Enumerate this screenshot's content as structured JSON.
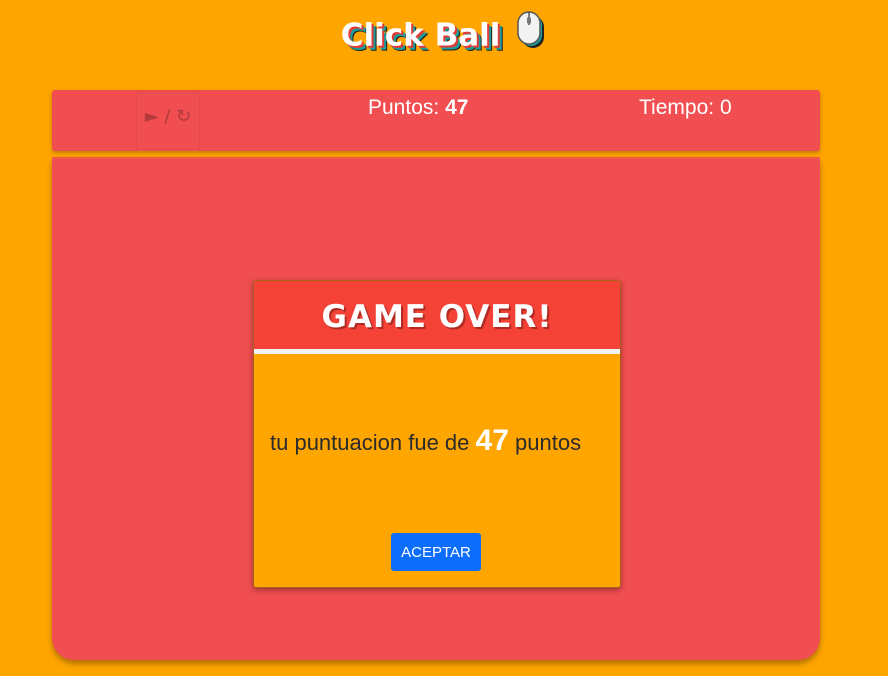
{
  "header": {
    "title": "Click Ball",
    "icon": "mouse-icon"
  },
  "toolbar": {
    "play_glyph": "►",
    "separator": "/",
    "restart_glyph": "↻",
    "points_label": "Puntos:",
    "points_value": "47",
    "time_label": "Tiempo:",
    "time_value": "0"
  },
  "dialog": {
    "title": "GAME OVER!",
    "message_prefix": "tu puntuacion fue de",
    "score": "47",
    "message_suffix": "puntos",
    "accept_label": "ACEPTAR"
  },
  "colors": {
    "background": "#ffa500",
    "panel": "#f04e50",
    "dialog_header": "#f44336",
    "accept_button": "#0d6efd"
  }
}
